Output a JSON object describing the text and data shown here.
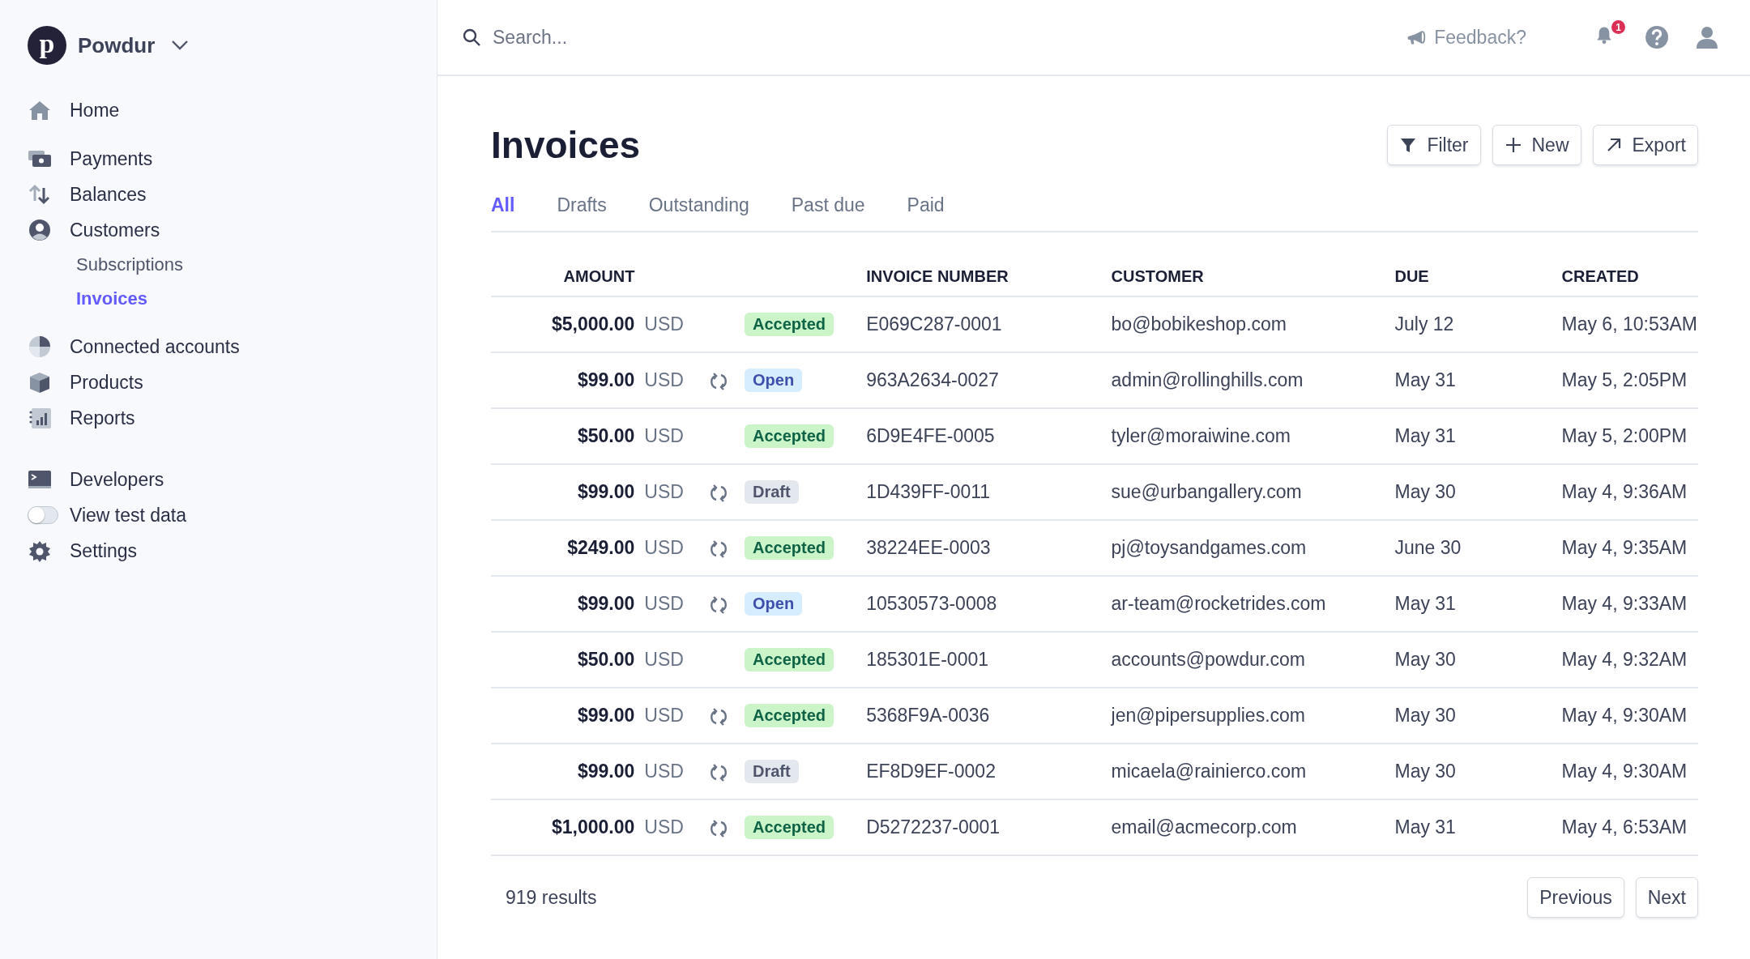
{
  "sidebar": {
    "account": {
      "initial": "p",
      "name": "Powdur"
    },
    "groups": [
      {
        "items": [
          {
            "label": "Home",
            "selected": false
          }
        ]
      },
      {
        "items": [
          {
            "label": "Payments",
            "selected": false
          },
          {
            "label": "Balances",
            "selected": false
          },
          {
            "label": "Customers",
            "selected": false,
            "children": [
              {
                "label": "Subscriptions",
                "selected": false
              },
              {
                "label": "Invoices",
                "selected": true
              }
            ]
          }
        ]
      },
      {
        "items": [
          {
            "label": "Connected accounts",
            "selected": false
          },
          {
            "label": "Products",
            "selected": false
          },
          {
            "label": "Reports",
            "selected": false
          }
        ]
      },
      {
        "items": [
          {
            "label": "Developers",
            "selected": false,
            "kind": "link"
          },
          {
            "label": "View test data",
            "selected": false,
            "kind": "toggle",
            "on": false
          },
          {
            "label": "Settings",
            "selected": false,
            "kind": "link"
          }
        ]
      }
    ]
  },
  "topbar": {
    "search": {
      "placeholder": "Search..."
    },
    "feedback": "Feedback?",
    "notifications": "1"
  },
  "page": {
    "title": "Invoices",
    "actions": [
      "Filter",
      "New",
      "Export"
    ],
    "tabs": [
      {
        "label": "All",
        "selected": true
      },
      {
        "label": "Drafts",
        "selected": false
      },
      {
        "label": "Outstanding",
        "selected": false
      },
      {
        "label": "Past due",
        "selected": false
      },
      {
        "label": "Paid",
        "selected": false
      }
    ]
  },
  "table": {
    "columns": [
      "AMOUNT",
      "INVOICE NUMBER",
      "CUSTOMER",
      "DUE",
      "CREATED"
    ],
    "rows": [
      {
        "amount": "$5,000.00",
        "currency": "USD",
        "recurring": false,
        "status": "Accepted",
        "kind": "accepted",
        "number": "E069C287-0001",
        "customer": "bo@bobikeshop.com",
        "due": "July 12",
        "created": "May 6, 10:53AM"
      },
      {
        "amount": "$99.00",
        "currency": "USD",
        "recurring": true,
        "status": "Open",
        "kind": "open",
        "number": "963A2634-0027",
        "customer": "admin@rollinghills.com",
        "due": "May 31",
        "created": "May 5, 2:05PM"
      },
      {
        "amount": "$50.00",
        "currency": "USD",
        "recurring": false,
        "status": "Accepted",
        "kind": "accepted",
        "number": "6D9E4FE-0005",
        "customer": "tyler@moraiwine.com",
        "due": "May 31",
        "created": "May 5, 2:00PM"
      },
      {
        "amount": "$99.00",
        "currency": "USD",
        "recurring": true,
        "status": "Draft",
        "kind": "draft",
        "number": "1D439FF-0011",
        "customer": "sue@urbangallery.com",
        "due": "May 30",
        "created": "May 4, 9:36AM"
      },
      {
        "amount": "$249.00",
        "currency": "USD",
        "recurring": true,
        "status": "Accepted",
        "kind": "accepted",
        "number": "38224EE-0003",
        "customer": "pj@toysandgames.com",
        "due": "June 30",
        "created": "May 4, 9:35AM"
      },
      {
        "amount": "$99.00",
        "currency": "USD",
        "recurring": true,
        "status": "Open",
        "kind": "open",
        "number": "10530573-0008",
        "customer": "ar-team@rocketrides.com",
        "due": "May 31",
        "created": "May 4, 9:33AM"
      },
      {
        "amount": "$50.00",
        "currency": "USD",
        "recurring": false,
        "status": "Accepted",
        "kind": "accepted",
        "number": "185301E-0001",
        "customer": "accounts@powdur.com",
        "due": "May 30",
        "created": "May 4, 9:32AM"
      },
      {
        "amount": "$99.00",
        "currency": "USD",
        "recurring": true,
        "status": "Accepted",
        "kind": "accepted",
        "number": "5368F9A-0036",
        "customer": "jen@pipersupplies.com",
        "due": "May 30",
        "created": "May 4, 9:30AM"
      },
      {
        "amount": "$99.00",
        "currency": "USD",
        "recurring": true,
        "status": "Draft",
        "kind": "draft",
        "number": "EF8D9EF-0002",
        "customer": "micaela@rainierco.com",
        "due": "May 30",
        "created": "May 4, 9:30AM"
      },
      {
        "amount": "$1,000.00",
        "currency": "USD",
        "recurring": true,
        "status": "Accepted",
        "kind": "accepted",
        "number": "D5272237-0001",
        "customer": "email@acmecorp.com",
        "due": "May 31",
        "created": "May 4, 6:53AM"
      }
    ]
  },
  "footer": {
    "results": "919 results",
    "buttons": [
      "Previous",
      "Next"
    ]
  }
}
